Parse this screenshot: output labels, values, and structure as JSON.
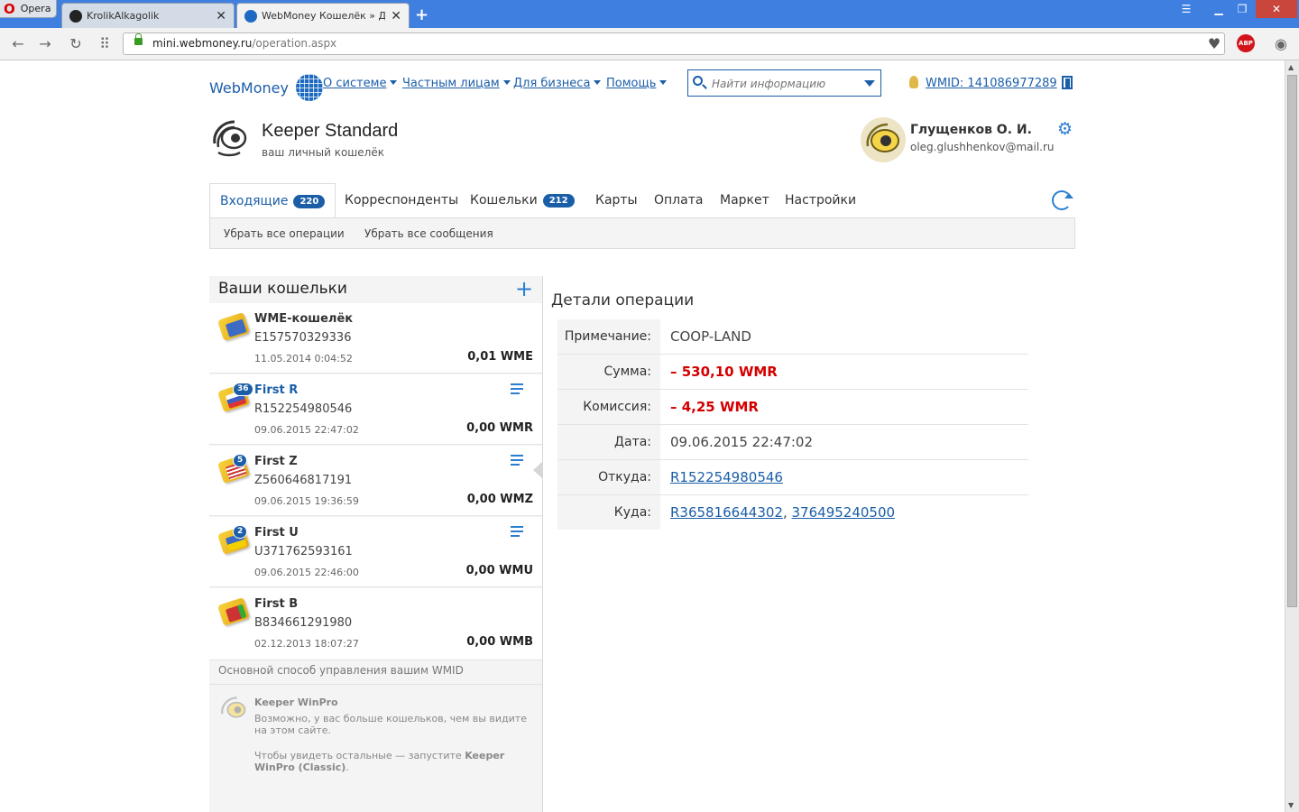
{
  "browser": {
    "opera_label": "Opera",
    "tabs": [
      {
        "title": "KrolikAlkagolik",
        "close": "✕"
      },
      {
        "title": "WebMoney Кошелёк » Детали операции",
        "close": "✕"
      }
    ],
    "new_tab": "+",
    "url_host": "mini.webmoney.ru",
    "url_path": "/operation.aspx",
    "abp": "ABP"
  },
  "header": {
    "logo_text": "WebMoney",
    "nav": [
      "О системе",
      "Частным лицам",
      "Для бизнеса",
      "Помощь"
    ],
    "search_placeholder": "Найти информацию",
    "wmid_label": "WMID: 141086977289"
  },
  "keeper": {
    "title": "Keeper Standard",
    "subtitle": "ваш личный кошелёк"
  },
  "user": {
    "name": "Глущенков О. И.",
    "email": "oleg.glushhenkov@mail.ru"
  },
  "tabs": [
    {
      "label": "Входящие",
      "badge": "220"
    },
    {
      "label": "Корреспонденты"
    },
    {
      "label": "Кошельки",
      "badge": "212"
    },
    {
      "label": "Карты"
    },
    {
      "label": "Оплата"
    },
    {
      "label": "Маркет"
    },
    {
      "label": "Настройки"
    }
  ],
  "subactions": [
    "Убрать все операции",
    "Убрать все сообщения"
  ],
  "wallets_panel": {
    "title": "Ваши кошельки",
    "add": "+",
    "wallets": [
      {
        "name": "WME-кошелёк",
        "number": "E157570329336",
        "date": "11.05.2014 0:04:52",
        "balance": "0,01 WME"
      },
      {
        "name": "First R",
        "badge": "36",
        "number": "R152254980546",
        "date": "09.06.2015 22:47:02",
        "balance": "0,00 WMR"
      },
      {
        "name": "First Z",
        "badge": "5",
        "number": "Z560646817191",
        "date": "09.06.2015 19:36:59",
        "balance": "0,00 WMZ"
      },
      {
        "name": "First U",
        "badge": "2",
        "number": "U371762593161",
        "date": "09.06.2015 22:46:00",
        "balance": "0,00 WMU"
      },
      {
        "name": "First B",
        "number": "B834661291980",
        "date": "02.12.2013 18:07:27",
        "balance": "0,00 WMB"
      }
    ],
    "mgmt_head": "Основной способ управления вашим WMID",
    "mgmt_title": "Keeper WinPro",
    "mgmt_text1": "Возможно, у вас больше кошельков, чем вы видите на этом сайте.",
    "mgmt_text2_pre": "Чтобы увидеть остальные — запустите ",
    "mgmt_text2_bold": "Keeper WinPro (Classic)",
    "mgmt_text2_post": "."
  },
  "details": {
    "title": "Детали операции",
    "rows": {
      "note": {
        "label": "Примечание:",
        "value": "COOP-LAND"
      },
      "amount": {
        "label": "Сумма:",
        "value": "– 530,10 WMR"
      },
      "fee": {
        "label": "Комиссия:",
        "value": "– 4,25 WMR"
      },
      "date": {
        "label": "Дата:",
        "value": "09.06.2015 22:47:02"
      },
      "from": {
        "label": "Откуда:",
        "value": "R152254980546"
      },
      "to": {
        "label": "Куда:",
        "value1": "R365816644302",
        "sep": ",",
        "value2": "376495240500"
      }
    }
  },
  "colors": {
    "accent": "#1b5ea8",
    "negative": "#d40000",
    "browser_bar": "#3f7fe0"
  }
}
